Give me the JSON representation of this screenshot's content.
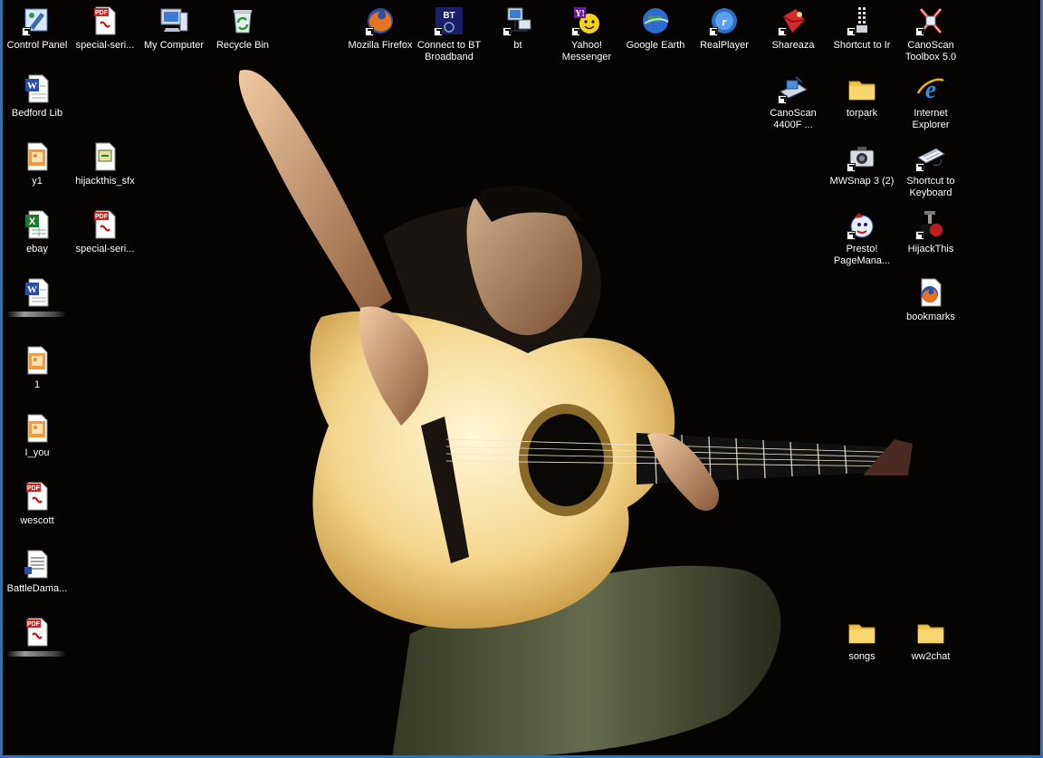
{
  "desktop": {
    "icons": [
      {
        "label": "Control Panel",
        "icon": "control-panel-icon",
        "shortcut": true
      },
      {
        "label": "special-seri...",
        "icon": "pdf-file-icon",
        "shortcut": false
      },
      {
        "label": "My Computer",
        "icon": "my-computer-icon",
        "shortcut": false
      },
      {
        "label": "Recycle Bin",
        "icon": "recycle-bin-icon",
        "shortcut": false
      },
      {
        "label": "Mozilla Firefox",
        "icon": "firefox-icon",
        "shortcut": true
      },
      {
        "label": "Connect to BT\nBroadband",
        "icon": "bt-broadband-icon",
        "shortcut": true
      },
      {
        "label": "bt",
        "icon": "network-computer-icon",
        "shortcut": true
      },
      {
        "label": "Yahoo!\nMessenger",
        "icon": "yahoo-messenger-icon",
        "shortcut": true
      },
      {
        "label": "Google Earth",
        "icon": "google-earth-icon",
        "shortcut": false
      },
      {
        "label": "RealPlayer",
        "icon": "realplayer-icon",
        "shortcut": true
      },
      {
        "label": "Shareaza",
        "icon": "shareaza-icon",
        "shortcut": true
      },
      {
        "label": "Shortcut to Ir",
        "icon": "infrared-icon",
        "shortcut": true
      },
      {
        "label": "CanoScan\nToolbox 5.0",
        "icon": "canoscan-toolbox-icon",
        "shortcut": true
      },
      {
        "label": "Bedford Lib",
        "icon": "word-document-icon",
        "shortcut": false
      },
      {
        "label": "CanoScan\n4400F ...",
        "icon": "scanner-icon",
        "shortcut": true
      },
      {
        "label": "torpark",
        "icon": "folder-icon",
        "shortcut": false
      },
      {
        "label": "Internet\nExplorer",
        "icon": "internet-explorer-icon",
        "shortcut": false
      },
      {
        "label": "y1",
        "icon": "image-file-icon",
        "shortcut": false
      },
      {
        "label": "hijackthis_sfx",
        "icon": "installer-icon",
        "shortcut": false
      },
      {
        "label": "MWSnap 3 (2)",
        "icon": "camera-icon",
        "shortcut": true
      },
      {
        "label": "Shortcut to\nKeyboard",
        "icon": "keyboard-icon",
        "shortcut": true
      },
      {
        "label": "ebay",
        "icon": "excel-file-icon",
        "shortcut": false
      },
      {
        "label": "special-seri...",
        "icon": "pdf-file-icon",
        "shortcut": false
      },
      {
        "label": "Presto!\nPageMana...",
        "icon": "presto-pagemanager-icon",
        "shortcut": true
      },
      {
        "label": "HijackThis",
        "icon": "hijackthis-icon",
        "shortcut": true
      },
      {
        "label": "",
        "icon": "word-document-icon",
        "shortcut": false
      },
      {
        "label": "bookmarks",
        "icon": "firefox-document-icon",
        "shortcut": false
      },
      {
        "label": "1",
        "icon": "image-file-icon",
        "shortcut": false
      },
      {
        "label": "I_you",
        "icon": "image-file-icon",
        "shortcut": false
      },
      {
        "label": "wescott",
        "icon": "pdf-file-icon",
        "shortcut": false
      },
      {
        "label": "BattleDama...",
        "icon": "text-file-icon",
        "shortcut": false
      },
      {
        "label": "",
        "icon": "pdf-file-icon",
        "shortcut": false
      },
      {
        "label": "songs",
        "icon": "folder-icon",
        "shortcut": false
      },
      {
        "label": "ww2chat",
        "icon": "folder-icon",
        "shortcut": false
      }
    ]
  },
  "colors": {
    "frame": "#3a6ea5",
    "background": "#050403",
    "label_text": "#ffffff"
  }
}
